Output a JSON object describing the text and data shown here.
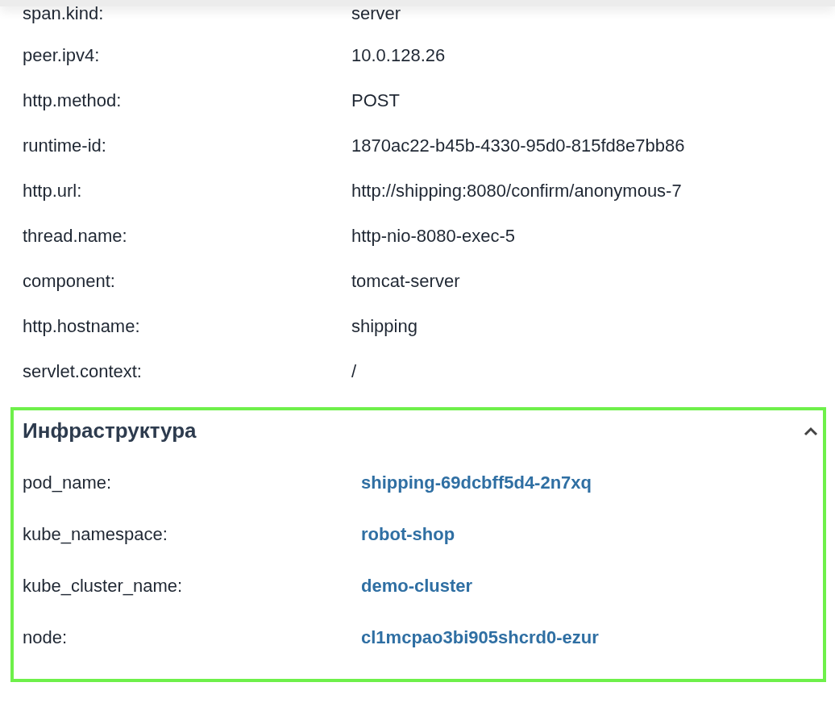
{
  "attributes": [
    {
      "key": "span.kind:",
      "value": "server"
    },
    {
      "key": "peer.ipv4:",
      "value": "10.0.128.26"
    },
    {
      "key": "http.method:",
      "value": "POST"
    },
    {
      "key": "runtime-id:",
      "value": "1870ac22-b45b-4330-95d0-815fd8e7bb86"
    },
    {
      "key": "http.url:",
      "value": "http://shipping:8080/confirm/anonymous-7"
    },
    {
      "key": "thread.name:",
      "value": "http-nio-8080-exec-5"
    },
    {
      "key": "component:",
      "value": "tomcat-server"
    },
    {
      "key": "http.hostname:",
      "value": "shipping"
    },
    {
      "key": "servlet.context:",
      "value": "/"
    }
  ],
  "infrastructure": {
    "title": "Инфраструктура",
    "expanded": true,
    "items": [
      {
        "key": "pod_name:",
        "value": "shipping-69dcbff5d4-2n7xq"
      },
      {
        "key": "kube_namespace:",
        "value": "robot-shop"
      },
      {
        "key": "kube_cluster_name:",
        "value": "demo-cluster"
      },
      {
        "key": "node:",
        "value": "cl1mcpao3bi905shcrd0-ezur"
      }
    ]
  }
}
